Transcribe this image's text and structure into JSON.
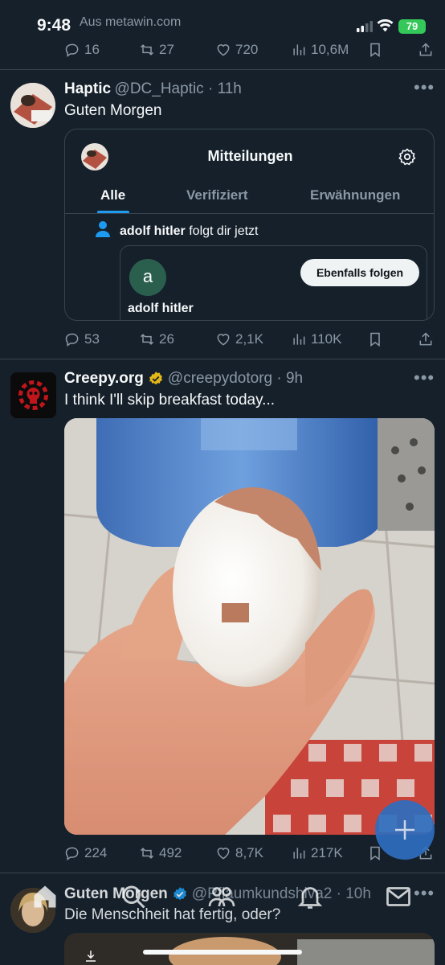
{
  "status_bar": {
    "time": "9:48",
    "back_label": "Aus metawin.com",
    "battery": "79"
  },
  "top_actions": {
    "replies": "16",
    "retweets": "27",
    "likes": "720",
    "views": "10,6M"
  },
  "tweet1": {
    "name": "Haptic",
    "handle": "@DC_Haptic · 11h",
    "text": "Guten Morgen",
    "card": {
      "title": "Mitteilungen",
      "tabs": [
        "Alle",
        "Verifiziert",
        "Erwähnungen"
      ],
      "notif_user": "adolf hitler",
      "notif_text": "folgt dir jetzt",
      "avatar_letter": "a",
      "follow_button": "Ebenfalls folgen",
      "profile_name": "adolf hitler"
    },
    "actions": {
      "replies": "53",
      "retweets": "26",
      "likes": "2,1K",
      "views": "110K"
    }
  },
  "tweet2": {
    "name": "Creepy.org",
    "handle": "@creepydotorg · 9h",
    "text": "I think I'll skip breakfast today...",
    "actions": {
      "replies": "224",
      "retweets": "492",
      "likes": "8,7K",
      "views": "217K"
    }
  },
  "tweet3": {
    "name": "Guten Morgen",
    "handle": "@Pflaumkundshiva2 · 10h",
    "text": "Die Menschheit hat fertig, oder?"
  },
  "colors": {
    "background": "#15202b",
    "accent": "#1d9bf0",
    "muted": "#8b98a5"
  }
}
